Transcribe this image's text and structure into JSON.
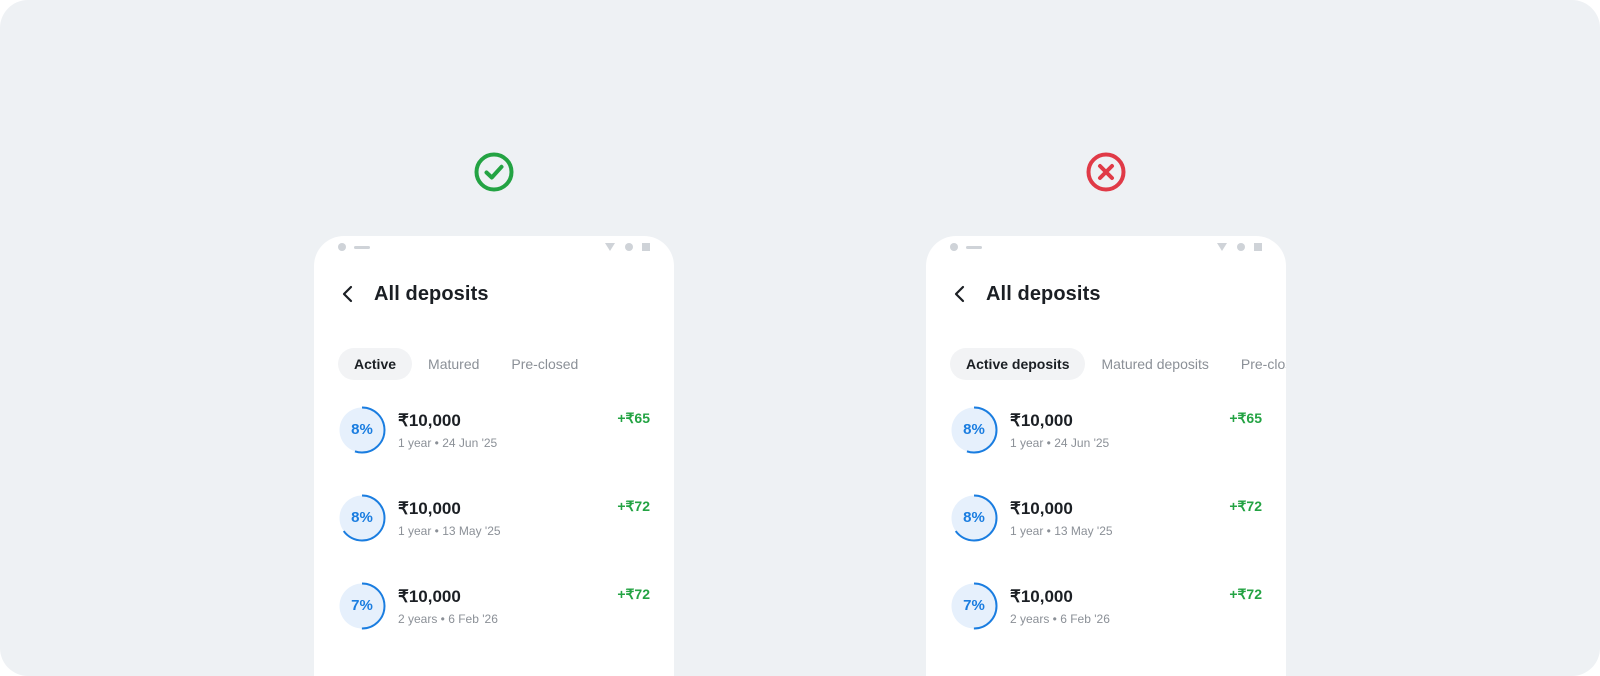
{
  "colors": {
    "canvas_bg": "#eef1f4",
    "good": "#23a343",
    "bad": "#e03a47",
    "accent": "#1a7de0",
    "gain": "#23a343"
  },
  "do": {
    "verdict_icon": "check-circle-icon",
    "title": "All deposits",
    "back_icon": "chevron-left-icon",
    "tabs": [
      {
        "label": "Active",
        "active": true
      },
      {
        "label": "Matured",
        "active": false
      },
      {
        "label": "Pre-closed",
        "active": false
      }
    ],
    "deposits": [
      {
        "rate": "8%",
        "progress": 0.55,
        "amount": "₹10,000",
        "meta": "1 year • 24 Jun '25",
        "gain": "+₹65"
      },
      {
        "rate": "8%",
        "progress": 0.65,
        "amount": "₹10,000",
        "meta": "1 year • 13 May '25",
        "gain": "+₹72"
      },
      {
        "rate": "7%",
        "progress": 0.5,
        "amount": "₹10,000",
        "meta": "2 years • 6 Feb '26",
        "gain": "+₹72"
      }
    ]
  },
  "dont": {
    "verdict_icon": "x-circle-icon",
    "title": "All deposits",
    "back_icon": "chevron-left-icon",
    "tabs": [
      {
        "label": "Active deposits",
        "active": true
      },
      {
        "label": "Matured deposits",
        "active": false
      },
      {
        "label": "Pre-closed deposits",
        "active": false
      }
    ],
    "deposits": [
      {
        "rate": "8%",
        "progress": 0.55,
        "amount": "₹10,000",
        "meta": "1 year • 24 Jun '25",
        "gain": "+₹65"
      },
      {
        "rate": "8%",
        "progress": 0.65,
        "amount": "₹10,000",
        "meta": "1 year • 13 May '25",
        "gain": "+₹72"
      },
      {
        "rate": "7%",
        "progress": 0.5,
        "amount": "₹10,000",
        "meta": "2 years • 6 Feb '26",
        "gain": "+₹72"
      }
    ]
  }
}
